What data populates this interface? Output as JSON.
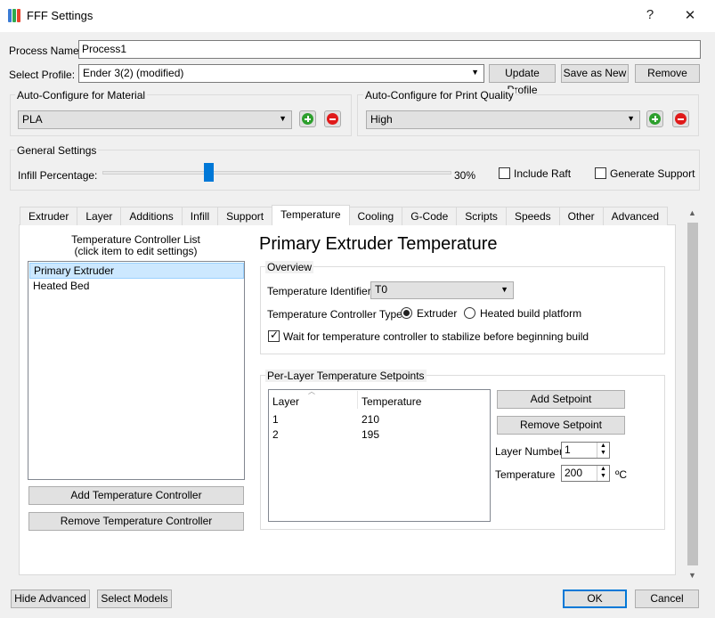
{
  "window": {
    "title": "FFF Settings",
    "help_glyph": "?",
    "close_glyph": "✕"
  },
  "process": {
    "label": "Process Name:",
    "value": "Process1"
  },
  "profile": {
    "label": "Select Profile:",
    "value": "Ender 3(2) (modified)",
    "update_label": "Update Profile",
    "save_as_new_label": "Save as New",
    "remove_label": "Remove"
  },
  "material": {
    "group_title": "Auto-Configure for Material",
    "value": "PLA"
  },
  "quality": {
    "group_title": "Auto-Configure for Print Quality",
    "value": "High"
  },
  "general": {
    "group_title": "General Settings",
    "infill_label": "Infill Percentage:",
    "infill_value": 0.3,
    "infill_text": "30%",
    "include_raft_label": "Include Raft",
    "include_raft_checked": false,
    "generate_support_label": "Generate Support",
    "generate_support_checked": false
  },
  "tabs": [
    {
      "label": "Extruder",
      "active": false
    },
    {
      "label": "Layer",
      "active": false
    },
    {
      "label": "Additions",
      "active": false
    },
    {
      "label": "Infill",
      "active": false
    },
    {
      "label": "Support",
      "active": false
    },
    {
      "label": "Temperature",
      "active": true
    },
    {
      "label": "Cooling",
      "active": false
    },
    {
      "label": "G-Code",
      "active": false
    },
    {
      "label": "Scripts",
      "active": false
    },
    {
      "label": "Speeds",
      "active": false
    },
    {
      "label": "Other",
      "active": false
    },
    {
      "label": "Advanced",
      "active": false
    }
  ],
  "controller_list": {
    "title_line1": "Temperature Controller List",
    "title_line2": "(click item to edit settings)",
    "items": [
      {
        "label": "Primary Extruder",
        "selected": true
      },
      {
        "label": "Heated Bed",
        "selected": false
      }
    ],
    "add_label": "Add Temperature Controller",
    "remove_label": "Remove Temperature Controller"
  },
  "detail": {
    "heading": "Primary Extruder Temperature",
    "overview_title": "Overview",
    "identifier_label": "Temperature Identifier",
    "identifier_value": "T0",
    "type_label": "Temperature Controller Type:",
    "type_extruder_label": "Extruder",
    "type_bed_label": "Heated build platform",
    "type_selected": "Extruder",
    "wait_label": "Wait for temperature controller to stabilize before beginning build",
    "wait_checked": true
  },
  "setpoints": {
    "group_title": "Per-Layer Temperature Setpoints",
    "col_layer": "Layer",
    "col_temperature": "Temperature",
    "rows": [
      {
        "layer": "1",
        "temperature": "210"
      },
      {
        "layer": "2",
        "temperature": "195"
      }
    ],
    "add_label": "Add Setpoint",
    "remove_label": "Remove Setpoint",
    "layer_number_label": "Layer Number",
    "layer_number_value": "1",
    "temperature_label": "Temperature",
    "temperature_value": "200",
    "unit": "ºC"
  },
  "footer": {
    "hide_advanced_label": "Hide Advanced",
    "select_models_label": "Select Models",
    "ok_label": "OK",
    "cancel_label": "Cancel"
  },
  "colors": {
    "accent": "#0078d7",
    "add_icon": "#2d9f2d",
    "remove_icon": "#e01a1a",
    "selection": "#cce8ff"
  },
  "icons": {
    "app": "app-logo-icon",
    "add": "plus-circle-icon",
    "remove": "minus-circle-icon",
    "dropdown": "chevron-down-icon"
  }
}
